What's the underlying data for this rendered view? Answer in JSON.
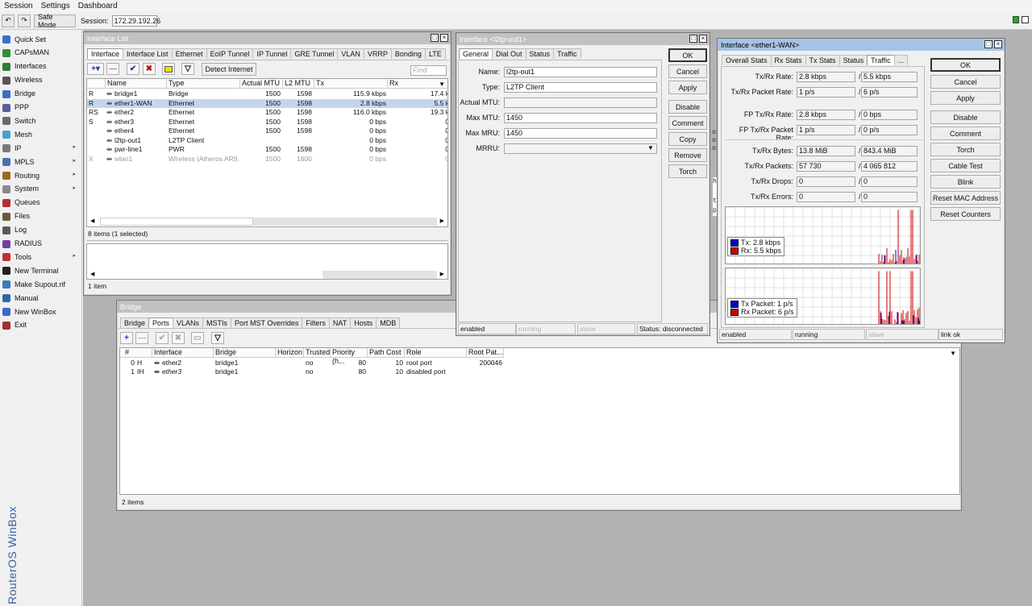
{
  "menu": [
    "Session",
    "Settings",
    "Dashboard"
  ],
  "toolbar": {
    "safe_mode": "Safe Mode",
    "session_label": "Session:",
    "session_value": "172.29.192.26"
  },
  "sidebar": {
    "brand": "RouterOS WinBox",
    "items": [
      "Quick Set",
      "CAPsMAN",
      "Interfaces",
      "Wireless",
      "Bridge",
      "PPP",
      "Switch",
      "Mesh",
      "IP",
      "MPLS",
      "Routing",
      "System",
      "Queues",
      "Files",
      "Log",
      "RADIUS",
      "Tools",
      "New Terminal",
      "Make Supout.rif",
      "Manual",
      "New WinBox",
      "Exit"
    ]
  },
  "iflist": {
    "title": "Interface List",
    "tabs": [
      "Interface",
      "Interface List",
      "Ethernet",
      "EoIP Tunnel",
      "IP Tunnel",
      "GRE Tunnel",
      "VLAN",
      "VRRP",
      "Bonding",
      "LTE"
    ],
    "detect_btn": "Detect Internet",
    "find_placeholder": "Find",
    "headers": [
      "Name",
      "Type",
      "Actual MTU",
      "L2 MTU",
      "Tx",
      "Rx"
    ],
    "rows": [
      {
        "flag": "R",
        "name": "bridge1",
        "type": "Bridge",
        "mtu": "1500",
        "l2": "1598",
        "tx": "115.9 kbps",
        "rx": "17.4 k"
      },
      {
        "flag": "R",
        "name": "ether1-WAN",
        "type": "Ethernet",
        "mtu": "1500",
        "l2": "1598",
        "tx": "2.8 kbps",
        "rx": "5.5 k"
      },
      {
        "flag": "RS",
        "name": "ether2",
        "type": "Ethernet",
        "mtu": "1500",
        "l2": "1598",
        "tx": "116.0 kbps",
        "rx": "19.3 k"
      },
      {
        "flag": "S",
        "name": "ether3",
        "type": "Ethernet",
        "mtu": "1500",
        "l2": "1598",
        "tx": "0 bps",
        "rx": "0"
      },
      {
        "flag": "",
        "name": "ether4",
        "type": "Ethernet",
        "mtu": "1500",
        "l2": "1598",
        "tx": "0 bps",
        "rx": "0"
      },
      {
        "flag": "",
        "name": "l2tp-out1",
        "type": "L2TP Client",
        "mtu": "",
        "l2": "",
        "tx": "0 bps",
        "rx": "0"
      },
      {
        "flag": "",
        "name": "pwr-line1",
        "type": "PWR",
        "mtu": "1500",
        "l2": "1598",
        "tx": "0 bps",
        "rx": "0"
      },
      {
        "flag": "X",
        "name": "wlan1",
        "type": "Wireless (Atheros AR9...",
        "mtu": "1500",
        "l2": "1600",
        "tx": "0 bps",
        "rx": "0"
      }
    ],
    "count": "8 items (1 selected)",
    "count2": "1 item"
  },
  "l2tp": {
    "title": "Interface <l2tp-out1>",
    "tabs": [
      "General",
      "Dial Out",
      "Status",
      "Traffic"
    ],
    "fields": [
      {
        "label": "Name:",
        "value": "l2tp-out1"
      },
      {
        "label": "Type:",
        "value": "L2TP Client"
      },
      {
        "label": "Actual MTU:",
        "value": ""
      },
      {
        "label": "Max MTU:",
        "value": "1450"
      },
      {
        "label": "Max MRU:",
        "value": "1450"
      },
      {
        "label": "MRRU:",
        "value": ""
      }
    ],
    "buttons": [
      "OK",
      "Cancel",
      "Apply",
      "Disable",
      "Comment",
      "Copy",
      "Remove",
      "Torch"
    ],
    "status": [
      "enabled",
      "running",
      "slave",
      "Status: disconnected"
    ]
  },
  "ether1": {
    "title": "Interface <ether1-WAN>",
    "tabs": [
      "Overall Stats",
      "Rx Stats",
      "Tx Stats",
      "Status",
      "Traffic",
      "..."
    ],
    "stats": [
      {
        "label": "Tx/Rx Rate:",
        "tx": "2.8 kbps",
        "rx": "5.5 kbps"
      },
      {
        "label": "Tx/Rx Packet Rate:",
        "tx": "1 p/s",
        "rx": "6 p/s"
      },
      {
        "label": "FP Tx/Rx Rate:",
        "tx": "2.8 kbps",
        "rx": "0 bps"
      },
      {
        "label": "FP Tx/Rx Packet Rate:",
        "tx": "1 p/s",
        "rx": "0 p/s"
      },
      {
        "label": "Tx/Rx Bytes:",
        "tx": "13.8 MiB",
        "rx": "843.4 MiB"
      },
      {
        "label": "Tx/Rx Packets:",
        "tx": "57 730",
        "rx": "4 065 812"
      },
      {
        "label": "Tx/Rx Drops:",
        "tx": "0",
        "rx": "0"
      },
      {
        "label": "Tx/Rx Errors:",
        "tx": "0",
        "rx": "0"
      }
    ],
    "legend1": [
      "Tx:  2.8 kbps",
      "Rx:  5.5 kbps"
    ],
    "legend2": [
      "Tx Packet:  1 p/s",
      "Rx Packet:  6 p/s"
    ],
    "buttons": [
      "OK",
      "Cancel",
      "Apply",
      "Disable",
      "Comment",
      "Torch",
      "Cable Test",
      "Blink",
      "Reset MAC Address",
      "Reset Counters"
    ],
    "status": [
      "enabled",
      "running",
      "slave",
      "link ok"
    ],
    "colors": {
      "tx": "#0000cc",
      "rx": "#cc0000"
    }
  },
  "bridge": {
    "title": "Bridge",
    "tabs": [
      "Bridge",
      "Ports",
      "VLANs",
      "MSTIs",
      "Port MST Overrides",
      "Filters",
      "NAT",
      "Hosts",
      "MDB"
    ],
    "headers": [
      "#",
      "Interface",
      "Bridge",
      "Horizon",
      "Trusted",
      "Priority (h...",
      "Path Cost",
      "Role",
      "Root Pat..."
    ],
    "rows": [
      {
        "num": "0",
        "flag": "H",
        "iface": "ether2",
        "bridge": "bridge1",
        "horizon": "",
        "trusted": "no",
        "prio": "80",
        "cost": "10",
        "role": "root port",
        "root": "200046"
      },
      {
        "num": "1",
        "flag": "IH",
        "iface": "ether3",
        "bridge": "bridge1",
        "horizon": "",
        "trusted": "no",
        "prio": "80",
        "cost": "10",
        "role": "disabled port",
        "root": ""
      }
    ],
    "count": "2 items"
  },
  "background_text": [
    "h",
    "ox",
    "ox",
    "ox",
    "t",
    "p"
  ]
}
